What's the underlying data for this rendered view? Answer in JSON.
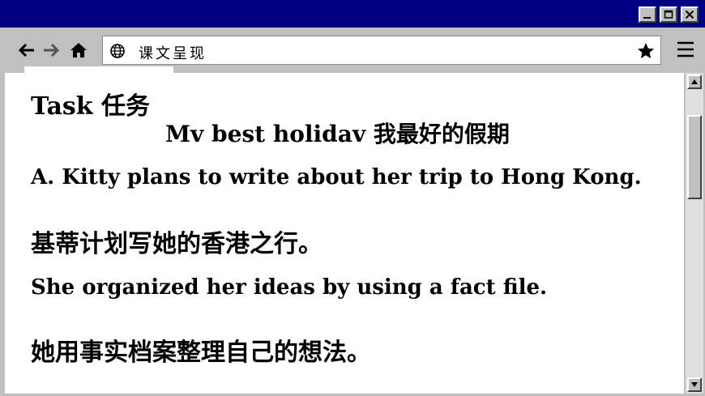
{
  "window": {
    "minimize_icon": "minimize-icon",
    "maximize_icon": "maximize-icon",
    "close_icon": "close-icon"
  },
  "toolbar": {
    "back_icon": "back-arrow-icon",
    "forward_icon": "forward-arrow-icon",
    "home_icon": "home-icon",
    "url": "课文呈现",
    "bookmark_icon": "star-icon",
    "menu_icon": "hamburger-menu-icon"
  },
  "document": {
    "task_heading": "Task 任务",
    "subtitle": "Mv best holidav  我最好的假期",
    "line1": "A. Kitty plans to write about her trip to Hong Kong.",
    "line2": "基蒂计划写她的香港之行。",
    "line3": "She organized her ideas by using a fact file.",
    "line4": "她用事实档案整理自己的想法。"
  },
  "colors": {
    "titlebar": "#000080",
    "chrome": "#c0c0c0",
    "page": "#ffffff",
    "text": "#000000"
  }
}
